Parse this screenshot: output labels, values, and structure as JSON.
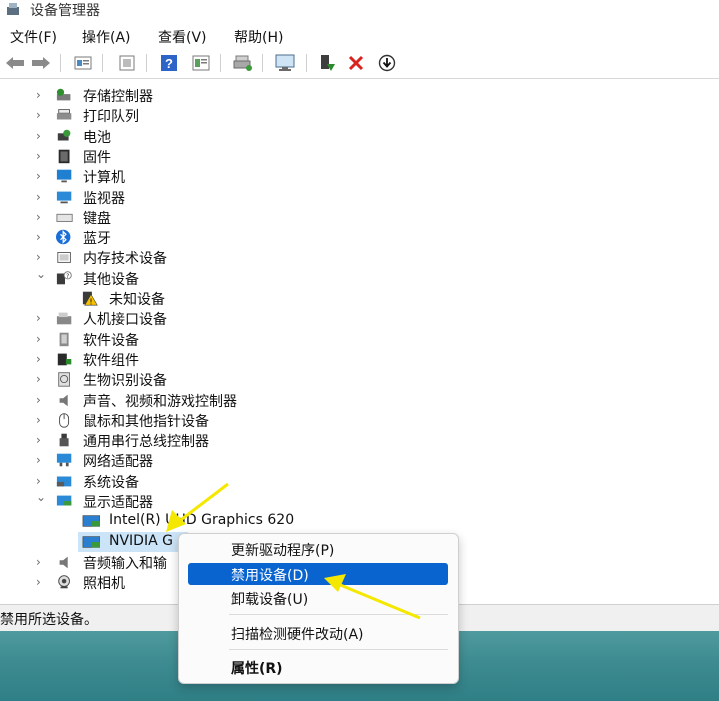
{
  "window": {
    "title": "设备管理器"
  },
  "menu": [
    "文件(F)",
    "操作(A)",
    "查看(V)",
    "帮助(H)"
  ],
  "toolbar": {
    "icons": [
      "back-arrow-icon",
      "forward-arrow-icon",
      "properties-icon",
      "driver-icon",
      "help-icon",
      "view-icon",
      "print-icon",
      "scan-hardware-icon",
      "enable-device-icon",
      "uninstall-x-icon",
      "update-driver-icon"
    ],
    "colors": {
      "uninstall": "#d8231f",
      "enable": "#2a8a2a"
    }
  },
  "tree": [
    {
      "label": "存储控制器",
      "icon": "storage-controller-icon"
    },
    {
      "label": "打印队列",
      "icon": "printer-icon"
    },
    {
      "label": "电池",
      "icon": "battery-icon"
    },
    {
      "label": "固件",
      "icon": "firmware-icon"
    },
    {
      "label": "计算机",
      "icon": "computer-icon"
    },
    {
      "label": "监视器",
      "icon": "monitor-icon"
    },
    {
      "label": "键盘",
      "icon": "keyboard-icon"
    },
    {
      "label": "蓝牙",
      "icon": "bluetooth-icon"
    },
    {
      "label": "内存技术设备",
      "icon": "memory-device-icon"
    },
    {
      "label": "其他设备",
      "icon": "other-devices-icon",
      "expanded": true
    },
    {
      "label": "未知设备",
      "icon": "unknown-device-warning-icon",
      "child": true
    },
    {
      "label": "人机接口设备",
      "icon": "hid-icon"
    },
    {
      "label": "软件设备",
      "icon": "software-device-icon"
    },
    {
      "label": "软件组件",
      "icon": "software-component-icon"
    },
    {
      "label": "生物识别设备",
      "icon": "biometric-icon"
    },
    {
      "label": "声音、视频和游戏控制器",
      "icon": "speaker-icon"
    },
    {
      "label": "鼠标和其他指针设备",
      "icon": "mouse-icon"
    },
    {
      "label": "通用串行总线控制器",
      "icon": "usb-icon"
    },
    {
      "label": "网络适配器",
      "icon": "network-adapter-icon"
    },
    {
      "label": "系统设备",
      "icon": "system-device-icon"
    },
    {
      "label": "显示适配器",
      "icon": "display-adapter-icon",
      "expanded": true
    },
    {
      "label": "Intel(R) UHD Graphics 620",
      "icon": "display-card-icon",
      "child": true
    },
    {
      "label": "NVIDIA G",
      "icon": "display-card-icon",
      "child": true,
      "selected": true
    },
    {
      "label": "音频输入和输",
      "icon": "audio-input-icon"
    },
    {
      "label": "照相机",
      "icon": "camera-icon"
    }
  ],
  "context_menu": {
    "items": [
      {
        "label": "更新驱动程序(P)"
      },
      {
        "label": "禁用设备(D)",
        "highlighted": true
      },
      {
        "label": "卸载设备(U)"
      },
      {
        "label": "扫描检测硬件改动(A)"
      },
      {
        "label": "属性(R)",
        "bold": true
      }
    ],
    "highlight_color": "#0a64d0"
  },
  "status": {
    "text": "禁用所选设备。"
  },
  "annotations": {
    "arrow_color": "#f5e800"
  }
}
